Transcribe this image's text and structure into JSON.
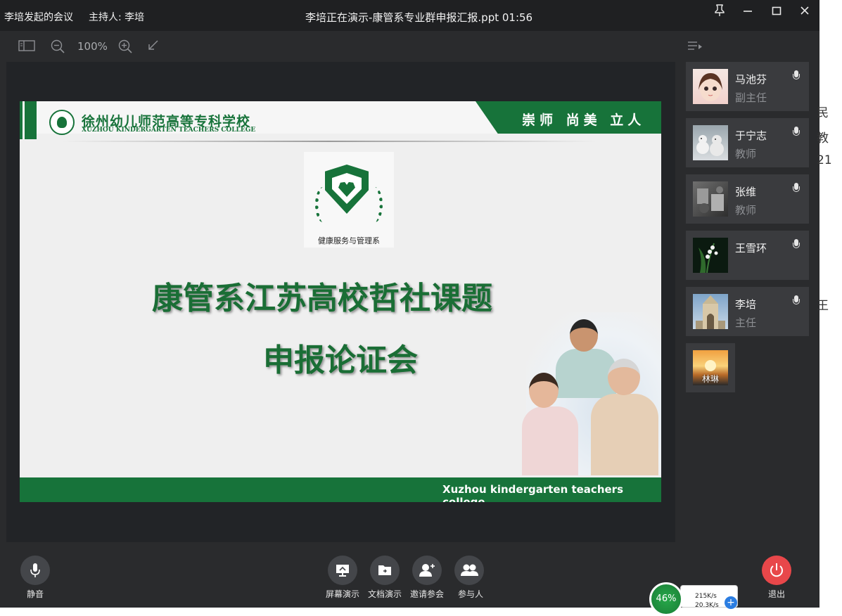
{
  "titlebar": {
    "meeting_title": "李培发起的会议",
    "host": "主持人: 李培",
    "presentation_title": "李培正在演示-康管系专业群申报汇报.ppt 01:56",
    "pin_icon": "pin-icon",
    "minimize_icon": "minimize-icon",
    "maximize_icon": "maximize-icon",
    "close_icon": "close-icon"
  },
  "toolbar": {
    "zoom_level": "100%",
    "sidebar_toggle_icon": "sidebar-toggle-icon",
    "zoom_out_icon": "zoom-out-icon",
    "zoom_in_icon": "zoom-in-icon",
    "collapse_icon": "collapse-arrow-icon"
  },
  "slide": {
    "school_name_cn": "徐州幼儿师范高等专科学校",
    "school_name_en": "XUZHOU KINDERGARTEN TEACHERS COLLEGE",
    "motto": "崇师 尚美 立人",
    "department": "健康服务与管理系",
    "title_line1": "康管系江苏高校哲社课题",
    "title_line2": "申报论证会",
    "footer_en_line1": "Xuzhou kindergarten teachers",
    "footer_en_line2": "college"
  },
  "participants": [
    {
      "name": "马池芬",
      "role": "副主任",
      "mic": true
    },
    {
      "name": "于宁志",
      "role": "教师",
      "mic": true
    },
    {
      "name": "张维",
      "role": "教师",
      "mic": true
    },
    {
      "name": "王雪环",
      "role": "",
      "mic": true
    },
    {
      "name": "李培",
      "role": "主任",
      "mic": true
    },
    {
      "name": "林琳",
      "role": "",
      "mic": false
    }
  ],
  "bottom": {
    "mute_label": "静音",
    "screen_share_label": "屏幕演示",
    "doc_share_label": "文档演示",
    "invite_label": "邀请参会",
    "participants_label": "参与人",
    "exit_label": "退出"
  },
  "network": {
    "percent": "46%",
    "upload": "215K/s",
    "download": "20.3K/s"
  },
  "background_text": [
    "民",
    "教",
    "21",
    "王"
  ],
  "colors": {
    "accent_green": "#17733a",
    "exit_red": "#e8474a"
  }
}
